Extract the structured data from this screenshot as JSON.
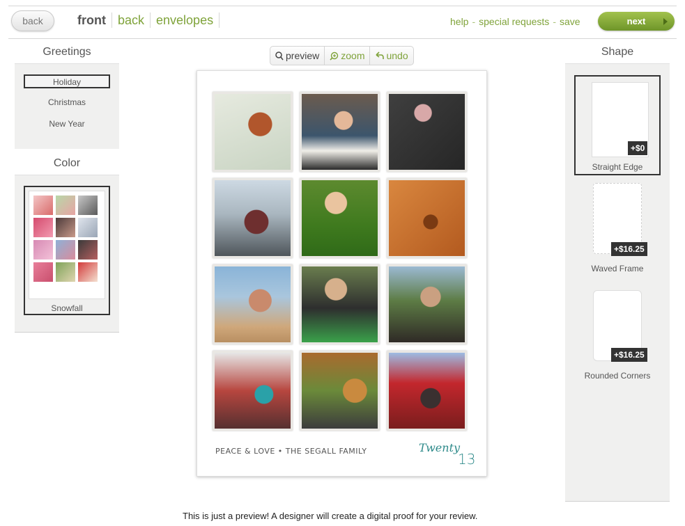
{
  "header": {
    "back_button": "back",
    "tabs": [
      {
        "label": "front",
        "active": true
      },
      {
        "label": "back",
        "active": false
      },
      {
        "label": "envelopes",
        "active": false
      }
    ],
    "links": [
      "help",
      "special requests",
      "save"
    ],
    "link_separator": "-",
    "next_button": "next"
  },
  "left_panel": {
    "greetings_title": "Greetings",
    "greetings": [
      {
        "label": "Holiday",
        "selected": true
      },
      {
        "label": "Christmas",
        "selected": false
      },
      {
        "label": "New Year",
        "selected": false
      }
    ],
    "color_title": "Color",
    "color_option": {
      "label": "Snowfall",
      "selected": true
    }
  },
  "toolbar": {
    "preview": "preview",
    "zoom": "zoom",
    "undo": "undo"
  },
  "card": {
    "photos": [
      "dog in snow",
      "child at piano",
      "child drawing with chalk",
      "mother and child at shore",
      "smiling child on grass",
      "golden dog close-up",
      "mother and child at beach",
      "child with toy train",
      "father and daughter at fountain",
      "costumed children on porch",
      "child with golden retriever",
      "family by fire truck"
    ],
    "footer_text": "PEACE & LOVE • THE SEGALL FAMILY",
    "year_script": "Twenty",
    "year_number": "13"
  },
  "notice": "This is just a preview! A designer will create a digital proof for your review.",
  "right_panel": {
    "shape_title": "Shape",
    "shapes": [
      {
        "label": "Straight Edge",
        "price": "+$0",
        "selected": true
      },
      {
        "label": "Waved Frame",
        "price": "+$16.25",
        "selected": false
      },
      {
        "label": "Rounded Corners",
        "price": "+$16.25",
        "selected": false
      }
    ]
  },
  "colors": {
    "accent_green": "#7fa33a",
    "next_button_green": "#86ad35",
    "year_teal": "#2e8a8a"
  }
}
